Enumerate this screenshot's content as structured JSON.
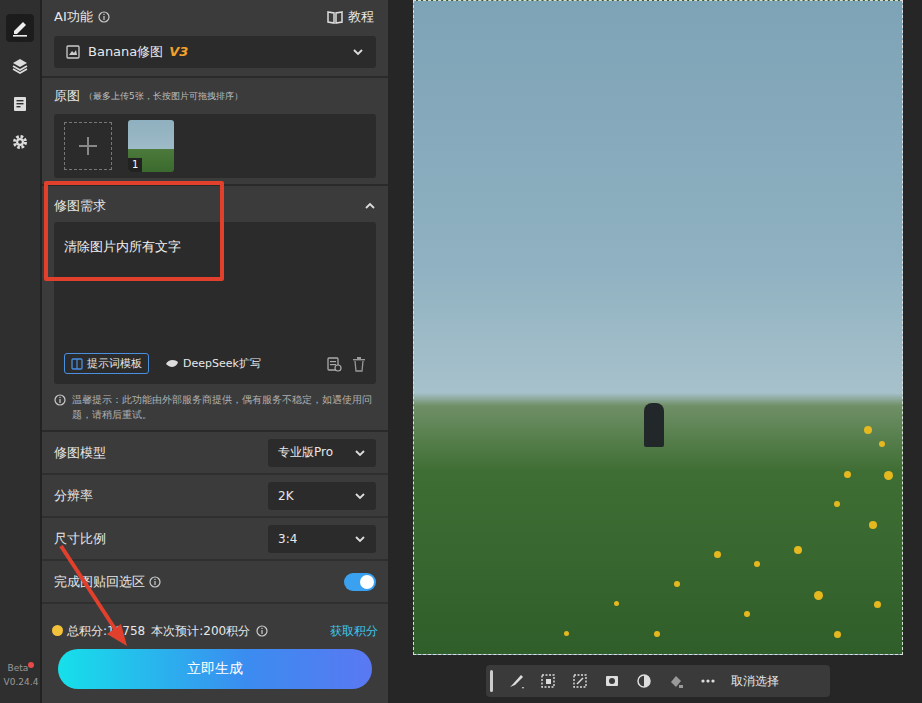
{
  "header": {
    "title": "AI功能",
    "tutorial": "教程"
  },
  "sidebar": {
    "items": [
      {
        "icon": "edit",
        "selected": true
      },
      {
        "icon": "layers",
        "selected": false
      },
      {
        "icon": "document",
        "selected": false
      },
      {
        "icon": "settings",
        "selected": false
      }
    ]
  },
  "feature_select": {
    "label": "Banana修图",
    "version": "V3"
  },
  "source": {
    "title": "原图",
    "hint": "（最多上传5张，长按图片可拖拽排序）",
    "images": [
      {
        "index": "1"
      }
    ]
  },
  "prompt": {
    "title": "修图需求",
    "expanded": true,
    "text": "清除图片内所有文字",
    "template_button": "提示词模板",
    "expand_button": "DeepSeek扩写"
  },
  "notice": "温馨提示：此功能由外部服务商提供，偶有服务不稳定，如遇使用问题，请稍后重试。",
  "settings": [
    {
      "label": "修图模型",
      "kind": "select",
      "value": "专业版Pro"
    },
    {
      "label": "分辨率",
      "kind": "select",
      "value": "2K"
    },
    {
      "label": "尺寸比例",
      "kind": "select",
      "value": "3:4"
    },
    {
      "label": "完成图贴回选区",
      "kind": "toggle",
      "on": true
    }
  ],
  "points": {
    "total": "总积分:18758",
    "estimate": "本次预计:200积分",
    "get": "获取积分"
  },
  "generate_button": "立即生成",
  "version": {
    "beta": "Beta",
    "number": "V0.24.4"
  },
  "canvas_toolbar": {
    "cancel": "取消选择"
  }
}
